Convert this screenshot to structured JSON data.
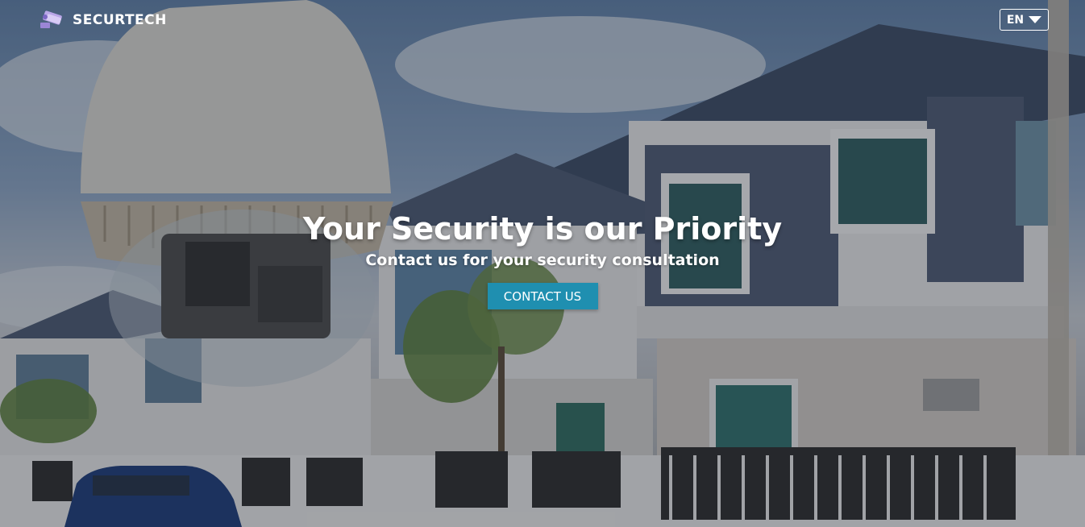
{
  "brand": {
    "name": "SECURTECH",
    "logo_icon": "camera-logo-icon"
  },
  "language": {
    "selected": "EN",
    "icon": "caret-down-icon"
  },
  "hero": {
    "title": "Your Security is our Priority",
    "subtitle": "Contact us for your security consultation",
    "cta_label": "CONTACT US",
    "background_image": "security camera in front of houses"
  },
  "colors": {
    "accent": "#1f8fb0",
    "text": "#ffffff"
  }
}
